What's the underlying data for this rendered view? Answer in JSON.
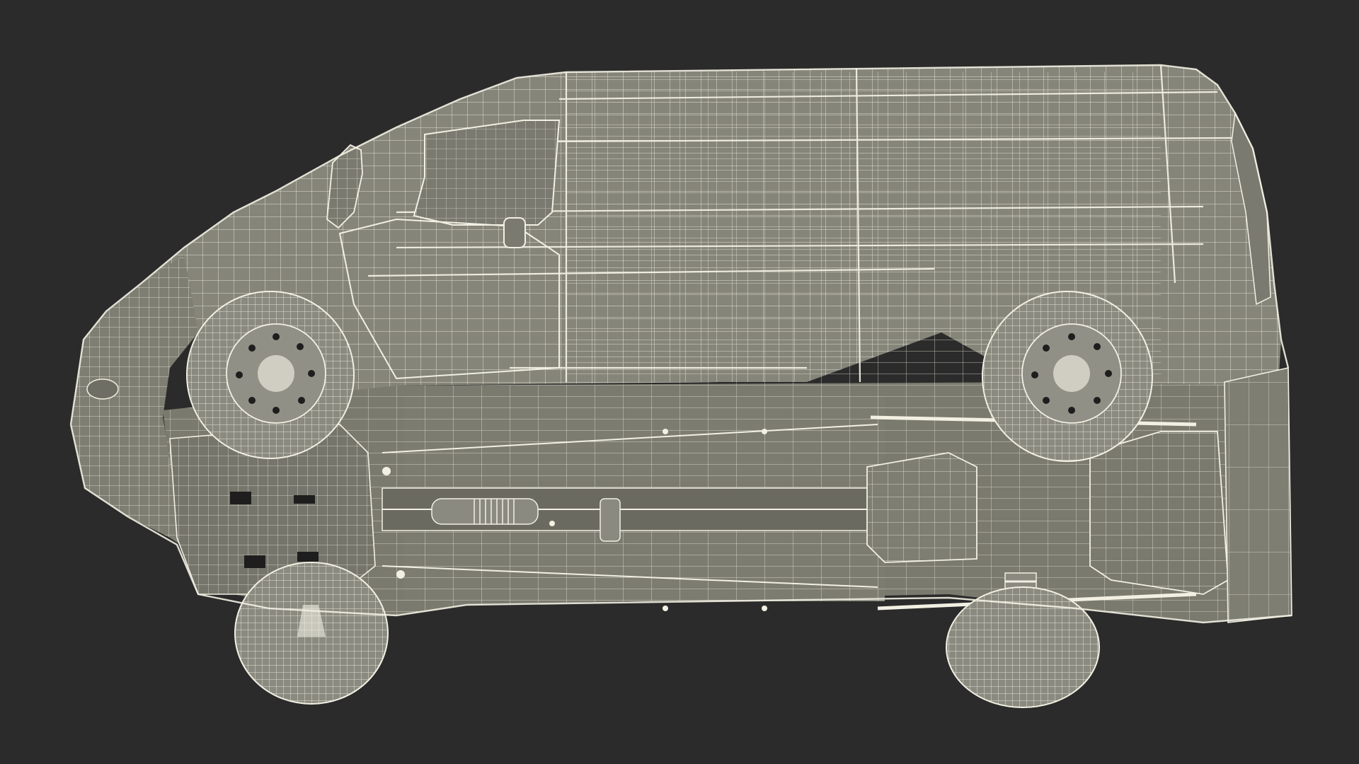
{
  "scene": {
    "background_color": "#2b2b2b",
    "subject": "wireframe-van-underside-view",
    "body_fill": "#85857a",
    "body_fill_dark": "#6e6e64",
    "wire_color": "#f2f0e2",
    "wheel_fill": "#8a8a80"
  }
}
